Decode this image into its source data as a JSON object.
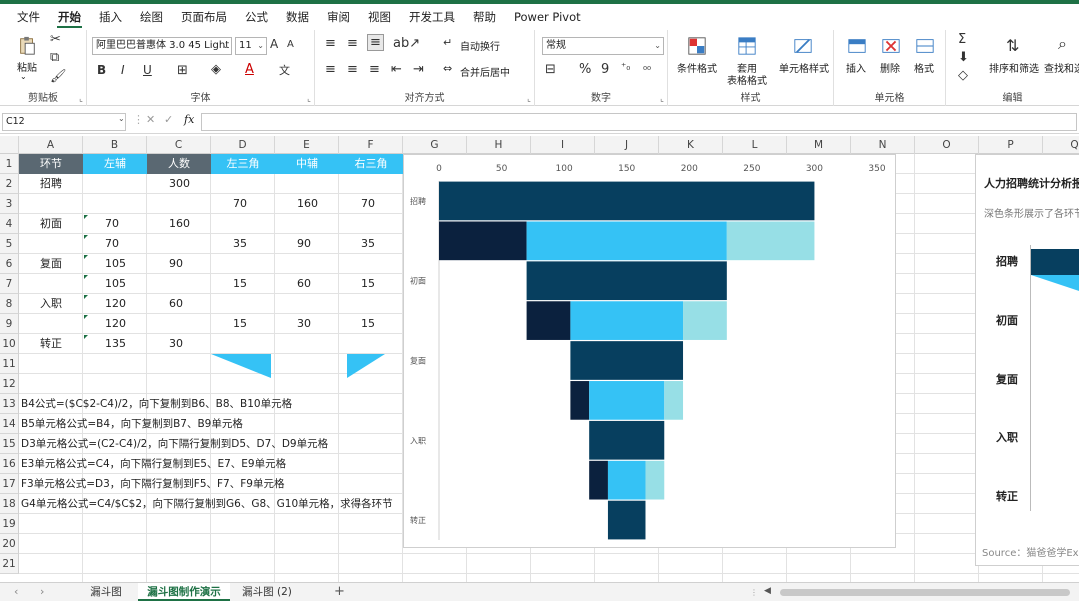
{
  "menu": [
    "文件",
    "开始",
    "插入",
    "绘图",
    "页面布局",
    "公式",
    "数据",
    "审阅",
    "视图",
    "开发工具",
    "帮助",
    "Power Pivot"
  ],
  "ribbon": {
    "clipboard": {
      "label": "剪贴板",
      "paste": "粘贴"
    },
    "font": {
      "label": "字体",
      "name": "阿里巴巴普惠体 3.0 45 Light",
      "size": "11",
      "bold": "B",
      "italic": "I",
      "underline": "U",
      "grow": "A",
      "shrink": "A"
    },
    "alignment": {
      "label": "对齐方式",
      "wrap": "自动换行",
      "merge": "合并后居中"
    },
    "number": {
      "label": "数字",
      "format": "常规",
      "percent": "%",
      "comma": "9"
    },
    "styles": {
      "label": "样式",
      "cond": "条件格式",
      "table1": "套用",
      "table2": "表格格式",
      "cell": "单元格样式"
    },
    "cells": {
      "label": "单元格",
      "insert": "插入",
      "delete": "删除",
      "format": "格式"
    },
    "editing": {
      "label": "编辑",
      "sortfilter": "排序和筛选",
      "find": "查找和选"
    }
  },
  "formula": {
    "namebox": "C12",
    "fx": "fx",
    "content": ""
  },
  "columns": [
    "A",
    "B",
    "C",
    "D",
    "E",
    "F",
    "G",
    "H",
    "I",
    "J",
    "K",
    "L",
    "M",
    "N",
    "O",
    "P",
    "Q"
  ],
  "rows": [
    "1",
    "2",
    "3",
    "4",
    "5",
    "6",
    "7",
    "8",
    "9",
    "10",
    "11",
    "12",
    "13",
    "14",
    "15",
    "16",
    "17",
    "18",
    "19",
    "20",
    "21"
  ],
  "table_headers": [
    "环节",
    "左辅",
    "人数",
    "左三角",
    "中辅",
    "右三角"
  ],
  "table_cells": [
    {
      "row": 2,
      "col": 0,
      "v": "招聘"
    },
    {
      "row": 2,
      "col": 2,
      "v": "300"
    },
    {
      "row": 3,
      "col": 3,
      "v": "70"
    },
    {
      "row": 3,
      "col": 4,
      "v": "160"
    },
    {
      "row": 3,
      "col": 5,
      "v": "70"
    },
    {
      "row": 4,
      "col": 0,
      "v": "初面"
    },
    {
      "row": 4,
      "col": 1,
      "v": "70"
    },
    {
      "row": 4,
      "col": 2,
      "v": "160"
    },
    {
      "row": 5,
      "col": 1,
      "v": "70"
    },
    {
      "row": 5,
      "col": 3,
      "v": "35"
    },
    {
      "row": 5,
      "col": 4,
      "v": "90"
    },
    {
      "row": 5,
      "col": 5,
      "v": "35"
    },
    {
      "row": 6,
      "col": 0,
      "v": "复面"
    },
    {
      "row": 6,
      "col": 1,
      "v": "105"
    },
    {
      "row": 6,
      "col": 2,
      "v": "90"
    },
    {
      "row": 7,
      "col": 1,
      "v": "105"
    },
    {
      "row": 7,
      "col": 3,
      "v": "15"
    },
    {
      "row": 7,
      "col": 4,
      "v": "60"
    },
    {
      "row": 7,
      "col": 5,
      "v": "15"
    },
    {
      "row": 8,
      "col": 0,
      "v": "入职"
    },
    {
      "row": 8,
      "col": 1,
      "v": "120"
    },
    {
      "row": 8,
      "col": 2,
      "v": "60"
    },
    {
      "row": 9,
      "col": 1,
      "v": "120"
    },
    {
      "row": 9,
      "col": 3,
      "v": "15"
    },
    {
      "row": 9,
      "col": 4,
      "v": "30"
    },
    {
      "row": 9,
      "col": 5,
      "v": "15"
    },
    {
      "row": 10,
      "col": 0,
      "v": "转正"
    },
    {
      "row": 10,
      "col": 1,
      "v": "135"
    },
    {
      "row": 10,
      "col": 2,
      "v": "30"
    }
  ],
  "notes": [
    {
      "row": 13,
      "text": "B4公式=($C$2-C4)/2，向下复制到B6、B8、B10单元格"
    },
    {
      "row": 14,
      "text": "B5单元格公式=B4，向下复制到B7、B9单元格"
    },
    {
      "row": 15,
      "text": "D3单元格公式=(C2-C4)/2，向下隔行复制到D5、D7、D9单元格"
    },
    {
      "row": 16,
      "text": "E3单元格公式=C4，向下隔行复制到E5、E7、E9单元格"
    },
    {
      "row": 17,
      "text": "F3单元格公式=D3，向下隔行复制到F5、F7、F9单元格"
    },
    {
      "row": 18,
      "text": "G4单元格公式=C4/$C$2，向下隔行复制到G6、G8、G10单元格，求得各环节"
    }
  ],
  "colors": {
    "dark": "#073f5f",
    "navy": "#0b213e",
    "sky": "#35c2f5",
    "pale": "#97dfe6",
    "header_dark": "#5a6872",
    "header_blue": "#35c2f5",
    "excel_green": "#1e7145"
  },
  "chart_data": {
    "type": "bar",
    "orientation": "horizontal-stacked",
    "xlim": [
      0,
      350
    ],
    "xticks": [
      0,
      50,
      100,
      150,
      200,
      250,
      300,
      350
    ],
    "category_labels": [
      "招聘",
      "初面",
      "复面",
      "入职",
      "转正"
    ],
    "bars": [
      {
        "segments": [
          {
            "start": 0,
            "len": 300,
            "color": "dark"
          }
        ]
      },
      {
        "segments": [
          {
            "start": 0,
            "len": 70,
            "color": "navy"
          },
          {
            "start": 70,
            "len": 160,
            "color": "sky"
          },
          {
            "start": 230,
            "len": 70,
            "color": "pale"
          }
        ]
      },
      {
        "segments": [
          {
            "start": 70,
            "len": 160,
            "color": "dark"
          }
        ]
      },
      {
        "segments": [
          {
            "start": 70,
            "len": 35,
            "color": "navy"
          },
          {
            "start": 105,
            "len": 90,
            "color": "sky"
          },
          {
            "start": 195,
            "len": 35,
            "color": "pale"
          }
        ]
      },
      {
        "segments": [
          {
            "start": 105,
            "len": 90,
            "color": "dark"
          }
        ]
      },
      {
        "segments": [
          {
            "start": 105,
            "len": 15,
            "color": "navy"
          },
          {
            "start": 120,
            "len": 60,
            "color": "sky"
          },
          {
            "start": 180,
            "len": 15,
            "color": "pale"
          }
        ]
      },
      {
        "segments": [
          {
            "start": 120,
            "len": 60,
            "color": "dark"
          }
        ]
      },
      {
        "segments": [
          {
            "start": 120,
            "len": 15,
            "color": "navy"
          },
          {
            "start": 135,
            "len": 30,
            "color": "sky"
          },
          {
            "start": 165,
            "len": 15,
            "color": "pale"
          }
        ]
      },
      {
        "segments": [
          {
            "start": 135,
            "len": 30,
            "color": "dark"
          }
        ]
      }
    ]
  },
  "chart2": {
    "title": "人力招聘统计分析报",
    "subtitle": "深色条形展示了各环节",
    "labels": [
      "招聘",
      "初面",
      "复面",
      "入职",
      "转正"
    ],
    "source": "Source：猫爸爸学Ex"
  },
  "tabs": [
    {
      "label": "漏斗图",
      "active": false
    },
    {
      "label": "漏斗图制作演示",
      "active": true
    },
    {
      "label": "漏斗图 (2)",
      "active": false
    }
  ],
  "tab_add": "+"
}
